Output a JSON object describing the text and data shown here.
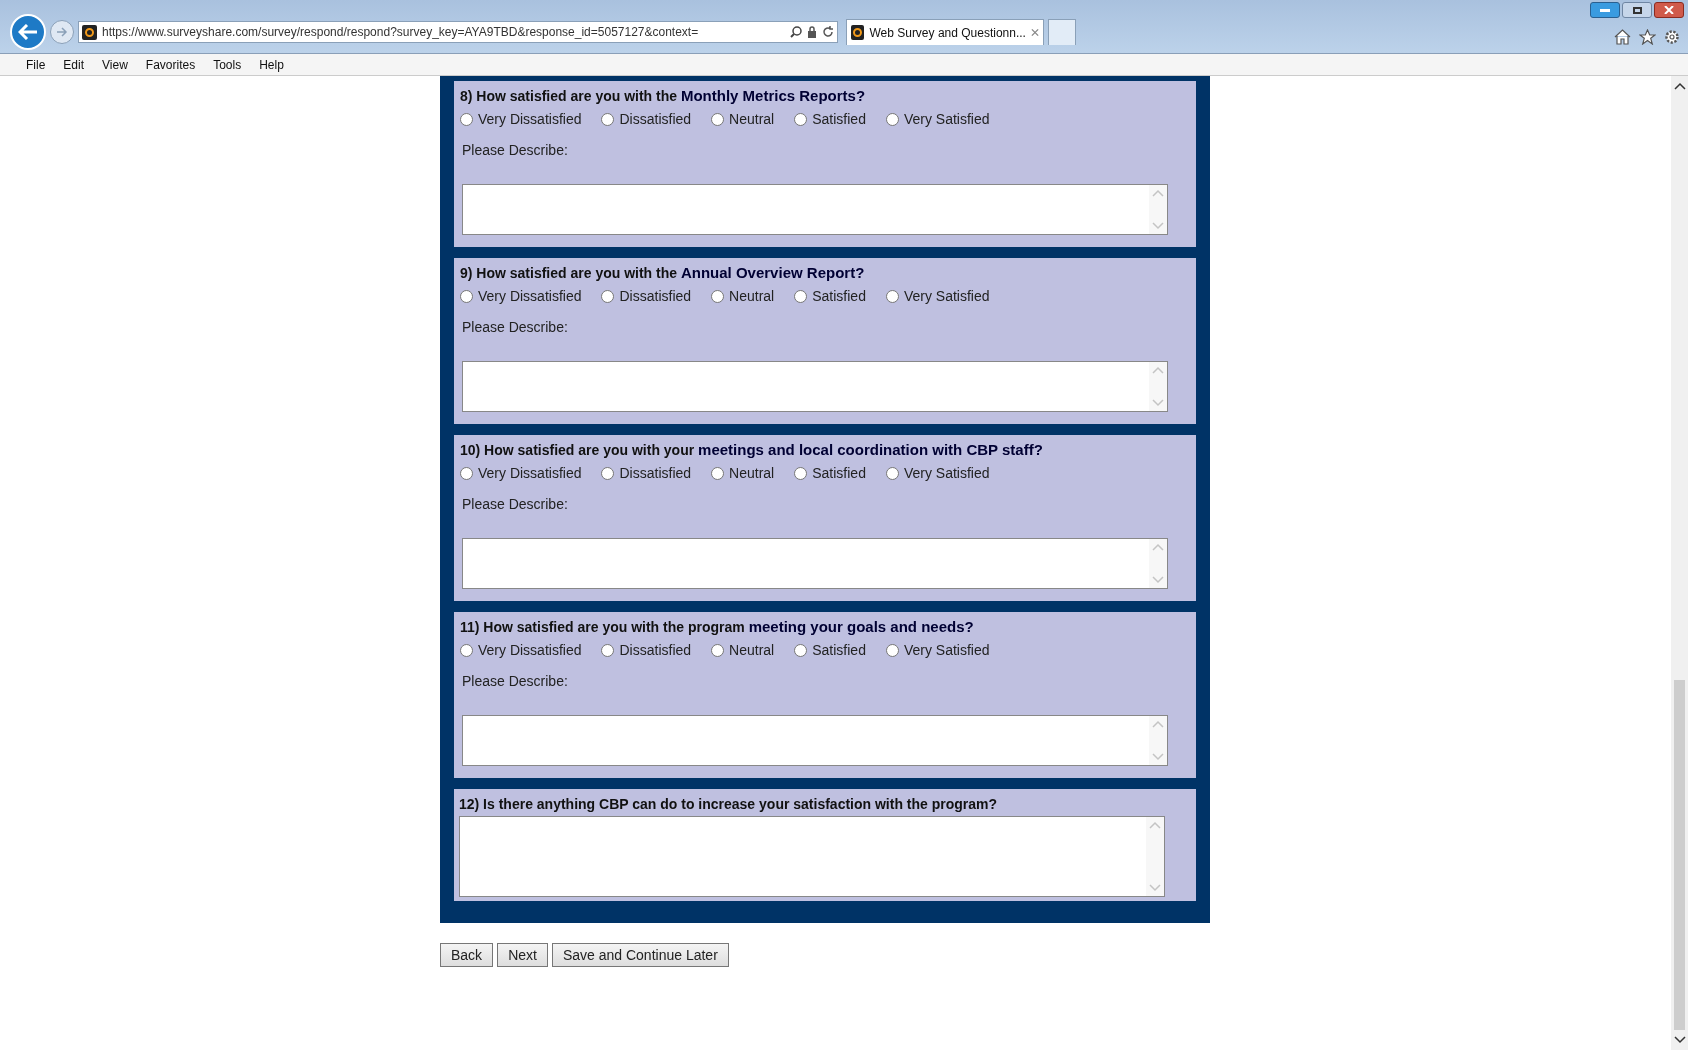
{
  "browser": {
    "address": "https://www.surveyshare.com/survey/respond/respond?survey_key=AYA9TBD&response_id=5057127&context=",
    "tab": {
      "label": "Web Survey and Questionn...",
      "selected": true
    },
    "menu": [
      "File",
      "Edit",
      "View",
      "Favorites",
      "Tools",
      "Help"
    ]
  },
  "questions": [
    {
      "kind": "rating",
      "prefix": "8) How satisfied are you with the ",
      "emphasis": "Monthly Metrics Reports?",
      "options": [
        {
          "label": "Very Dissatisfied",
          "selected": false
        },
        {
          "label": "Dissatisfied",
          "selected": false
        },
        {
          "label": "Neutral",
          "selected": false
        },
        {
          "label": "Satisfied",
          "selected": false
        },
        {
          "label": "Very Satisfied",
          "selected": false
        }
      ],
      "describe_label": "Please Describe:"
    },
    {
      "kind": "rating",
      "prefix": "9) How satisfied are you with the ",
      "emphasis": "Annual Overview Report?",
      "options": [
        {
          "label": "Very Dissatisfied",
          "selected": false
        },
        {
          "label": "Dissatisfied",
          "selected": false
        },
        {
          "label": "Neutral",
          "selected": false
        },
        {
          "label": "Satisfied",
          "selected": false
        },
        {
          "label": "Very Satisfied",
          "selected": false
        }
      ],
      "describe_label": "Please Describe:"
    },
    {
      "kind": "rating",
      "prefix": "10) How satisfied are you with your ",
      "emphasis": "meetings and local coordination with CBP staff?",
      "options": [
        {
          "label": "Very Dissatisfied",
          "selected": false
        },
        {
          "label": "Dissatisfied",
          "selected": false
        },
        {
          "label": "Neutral",
          "selected": false
        },
        {
          "label": "Satisfied",
          "selected": false
        },
        {
          "label": "Very Satisfied",
          "selected": false
        }
      ],
      "describe_label": "Please Describe:"
    },
    {
      "kind": "rating",
      "prefix": "11) How satisfied are you with the program ",
      "emphasis": "meeting your goals and needs?",
      "options": [
        {
          "label": "Very Dissatisfied",
          "selected": false
        },
        {
          "label": "Dissatisfied",
          "selected": false
        },
        {
          "label": "Neutral",
          "selected": false
        },
        {
          "label": "Satisfied",
          "selected": false
        },
        {
          "label": "Very Satisfied",
          "selected": false
        }
      ],
      "describe_label": "Please Describe:"
    },
    {
      "kind": "open",
      "prefix": "12) Is there anything CBP can do to increase your satisfaction with the program?"
    }
  ],
  "buttons": [
    "Back",
    "Next",
    "Save and Continue Later"
  ]
}
